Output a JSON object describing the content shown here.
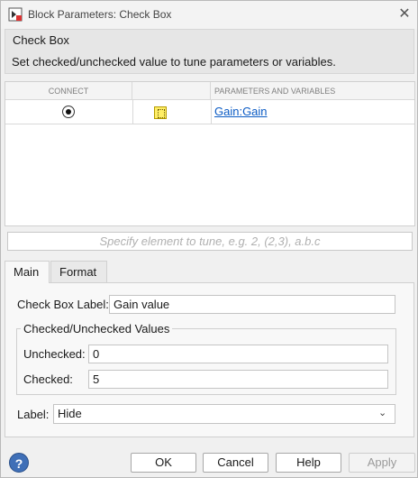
{
  "window": {
    "title": "Block Parameters: Check Box",
    "close_icon": "close-icon"
  },
  "header": {
    "title": "Check Box",
    "description": "Set checked/unchecked value to tune parameters or variables."
  },
  "table": {
    "columns": [
      "CONNECT",
      "",
      "PARAMETERS AND VARIABLES"
    ],
    "rows": [
      {
        "connected": true,
        "block_icon": "block-icon",
        "param": "Gain:Gain"
      }
    ]
  },
  "tune_input": {
    "placeholder": "Specify element to tune, e.g. 2, (2,3), a.b.c"
  },
  "tabs": [
    {
      "label": "Main",
      "active": true
    },
    {
      "label": "Format",
      "active": false
    }
  ],
  "main": {
    "checkbox_label_label": "Check Box Label:",
    "checkbox_label_value": "Gain value",
    "group_title": "Checked/Unchecked Values",
    "unchecked_label": "Unchecked:",
    "unchecked_value": "0",
    "checked_label": "Checked:",
    "checked_value": "5",
    "label_label": "Label:",
    "label_value": "Hide"
  },
  "footer": {
    "ok": "OK",
    "cancel": "Cancel",
    "help": "Help",
    "apply": "Apply"
  }
}
